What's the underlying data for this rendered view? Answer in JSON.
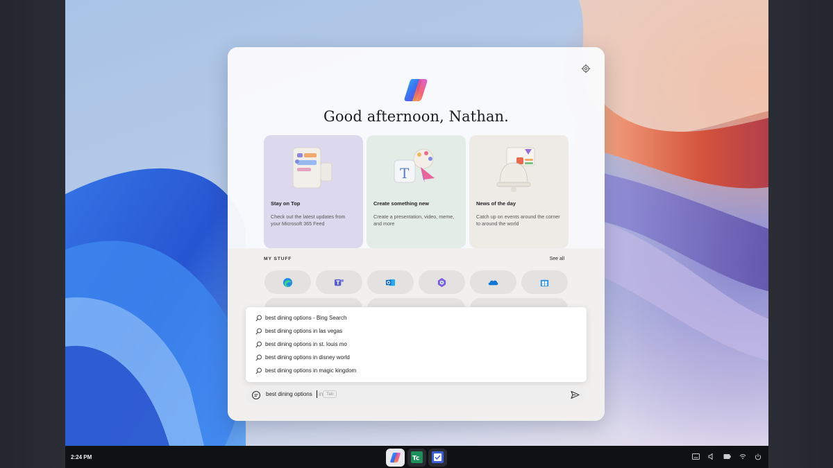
{
  "greeting": "Good afternoon, Nathan.",
  "cards": [
    {
      "title": "Stay on Top",
      "desc": "Check out the latest updates from your Microsoft 365 Feed",
      "bg": "#dcd9ef"
    },
    {
      "title": "Create something new",
      "desc": "Create a presentation, video, meme, and more",
      "bg": "#e4ece8"
    },
    {
      "title": "News of the day",
      "desc": "Catch up on events around the corner to around the world",
      "bg": "#eeebe6"
    }
  ],
  "my_stuff": {
    "heading": "MY STUFF",
    "see_all": "See all",
    "apps": [
      "edge-icon",
      "teams-icon",
      "outlook-icon",
      "loop-icon",
      "onedrive-icon",
      "store-icon"
    ]
  },
  "suggestions": [
    "best dining options - Bing Search",
    "best dining options in las vegas",
    "best dining options in st. louis mo",
    "best dining options in disney world",
    "best dining options in magic kingdom"
  ],
  "input": {
    "value": "best dining options",
    "ghost": "in",
    "tab_hint": "Tab"
  },
  "taskbar": {
    "time": "2:24 PM",
    "apps": [
      "copilot-icon",
      "terminal-app-icon",
      "todo-app-icon"
    ]
  }
}
